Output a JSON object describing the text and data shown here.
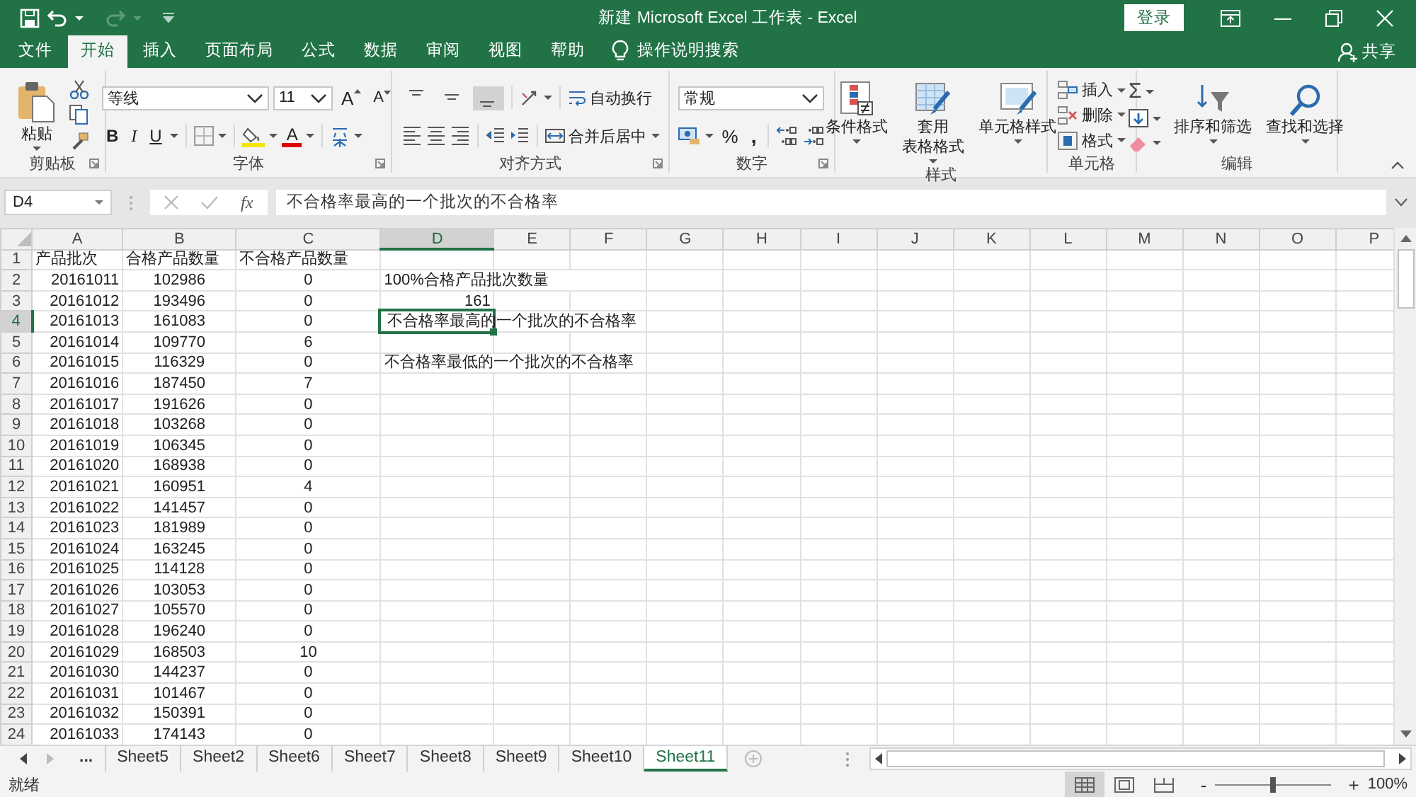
{
  "title_bar": {
    "title": "新建 Microsoft Excel 工作表 - Excel",
    "login": "登录"
  },
  "menu_tabs": [
    {
      "label": "文件",
      "selected": false
    },
    {
      "label": "开始",
      "selected": true
    },
    {
      "label": "插入",
      "selected": false
    },
    {
      "label": "页面布局",
      "selected": false
    },
    {
      "label": "公式",
      "selected": false
    },
    {
      "label": "数据",
      "selected": false
    },
    {
      "label": "审阅",
      "selected": false
    },
    {
      "label": "视图",
      "selected": false
    },
    {
      "label": "帮助",
      "selected": false
    }
  ],
  "tell_me": "操作说明搜索",
  "share": "共享",
  "ribbon": {
    "clipboard": {
      "label": "剪贴板",
      "paste": "粘贴"
    },
    "font": {
      "label": "字体",
      "font_name": "等线",
      "font_size": "11",
      "grow": "A",
      "shrink": "A",
      "bold": "B",
      "italic": "I",
      "underline": "U",
      "font_color": "A"
    },
    "alignment": {
      "label": "对齐方式",
      "vertical_align": [
        {
          "selected": false
        },
        {
          "selected": false
        },
        {
          "selected": true
        }
      ],
      "wrap_text": "自动换行",
      "merge_center": "合并后居中"
    },
    "number": {
      "label": "数字",
      "format": "常规",
      "percent": "%",
      "comma": ","
    },
    "styles": {
      "label": "样式",
      "buttons": [
        {
          "lines": [
            "条件格式"
          ]
        },
        {
          "lines": [
            "套用",
            "表格格式"
          ]
        },
        {
          "lines": [
            "单元格样式"
          ]
        }
      ]
    },
    "cells": {
      "label": "单元格",
      "buttons": [
        "插入",
        "删除",
        "格式"
      ]
    },
    "editing": {
      "label": "编辑",
      "sum": "Σ",
      "buttons": [
        "排序和筛选",
        "查找和选择"
      ]
    }
  },
  "formula_bar": {
    "name_box": "D4",
    "fx": "fx",
    "formula": "不合格率最高的一个批次的不合格率"
  },
  "columns": [
    {
      "label": "A",
      "selected": false
    },
    {
      "label": "B",
      "selected": false
    },
    {
      "label": "C",
      "selected": false
    },
    {
      "label": "D",
      "selected": true
    },
    {
      "label": "E",
      "selected": false
    },
    {
      "label": "F",
      "selected": false
    },
    {
      "label": "G",
      "selected": false
    },
    {
      "label": "H",
      "selected": false
    },
    {
      "label": "I",
      "selected": false
    },
    {
      "label": "J",
      "selected": false
    },
    {
      "label": "K",
      "selected": false
    },
    {
      "label": "L",
      "selected": false
    },
    {
      "label": "M",
      "selected": false
    },
    {
      "label": "N",
      "selected": false
    },
    {
      "label": "O",
      "selected": false
    },
    {
      "label": "P",
      "selected": false
    }
  ],
  "rows": [
    {
      "number": "1",
      "selected": false,
      "cells": [
        {
          "text": "产品批次",
          "kind": "text",
          "selected": false
        },
        {
          "text": "合格产品数量",
          "kind": "text",
          "selected": false
        },
        {
          "text": "不合格产品数量",
          "kind": "text",
          "selected": false
        }
      ]
    },
    {
      "number": "2",
      "selected": false,
      "cells": [
        {
          "text": "20161011",
          "kind": "number",
          "selected": false
        },
        {
          "text": "102986",
          "kind": "centered",
          "selected": false
        },
        {
          "text": "0",
          "kind": "centered",
          "selected": false
        },
        {
          "text": "100%合格产品批次数量",
          "kind": "text",
          "selected": false
        }
      ]
    },
    {
      "number": "3",
      "selected": false,
      "cells": [
        {
          "text": "20161012",
          "kind": "number",
          "selected": false
        },
        {
          "text": "193496",
          "kind": "centered",
          "selected": false
        },
        {
          "text": "0",
          "kind": "centered",
          "selected": false
        },
        {
          "text": "161",
          "kind": "number",
          "selected": false
        }
      ]
    },
    {
      "number": "4",
      "selected": true,
      "cells": [
        {
          "text": "20161013",
          "kind": "number",
          "selected": false
        },
        {
          "text": "161083",
          "kind": "centered",
          "selected": false
        },
        {
          "text": "0",
          "kind": "centered",
          "selected": false
        },
        {
          "text": "不合格率最高的一个批次的不合格率",
          "kind": "text",
          "selected": true
        }
      ]
    },
    {
      "number": "5",
      "selected": false,
      "cells": [
        {
          "text": "20161014",
          "kind": "number",
          "selected": false
        },
        {
          "text": "109770",
          "kind": "centered",
          "selected": false
        },
        {
          "text": "6",
          "kind": "centered",
          "selected": false
        }
      ]
    },
    {
      "number": "6",
      "selected": false,
      "cells": [
        {
          "text": "20161015",
          "kind": "number",
          "selected": false
        },
        {
          "text": "116329",
          "kind": "centered",
          "selected": false
        },
        {
          "text": "0",
          "kind": "centered",
          "selected": false
        },
        {
          "text": "不合格率最低的一个批次的不合格率",
          "kind": "text",
          "selected": false
        }
      ]
    },
    {
      "number": "7",
      "selected": false,
      "cells": [
        {
          "text": "20161016",
          "kind": "number",
          "selected": false
        },
        {
          "text": "187450",
          "kind": "centered",
          "selected": false
        },
        {
          "text": "7",
          "kind": "centered",
          "selected": false
        }
      ]
    },
    {
      "number": "8",
      "selected": false,
      "cells": [
        {
          "text": "20161017",
          "kind": "number",
          "selected": false
        },
        {
          "text": "191626",
          "kind": "centered",
          "selected": false
        },
        {
          "text": "0",
          "kind": "centered",
          "selected": false
        }
      ]
    },
    {
      "number": "9",
      "selected": false,
      "cells": [
        {
          "text": "20161018",
          "kind": "number",
          "selected": false
        },
        {
          "text": "103268",
          "kind": "centered",
          "selected": false
        },
        {
          "text": "0",
          "kind": "centered",
          "selected": false
        }
      ]
    },
    {
      "number": "10",
      "selected": false,
      "cells": [
        {
          "text": "20161019",
          "kind": "number",
          "selected": false
        },
        {
          "text": "106345",
          "kind": "centered",
          "selected": false
        },
        {
          "text": "0",
          "kind": "centered",
          "selected": false
        }
      ]
    },
    {
      "number": "11",
      "selected": false,
      "cells": [
        {
          "text": "20161020",
          "kind": "number",
          "selected": false
        },
        {
          "text": "168938",
          "kind": "centered",
          "selected": false
        },
        {
          "text": "0",
          "kind": "centered",
          "selected": false
        }
      ]
    },
    {
      "number": "12",
      "selected": false,
      "cells": [
        {
          "text": "20161021",
          "kind": "number",
          "selected": false
        },
        {
          "text": "160951",
          "kind": "centered",
          "selected": false
        },
        {
          "text": "4",
          "kind": "centered",
          "selected": false
        }
      ]
    },
    {
      "number": "13",
      "selected": false,
      "cells": [
        {
          "text": "20161022",
          "kind": "number",
          "selected": false
        },
        {
          "text": "141457",
          "kind": "centered",
          "selected": false
        },
        {
          "text": "0",
          "kind": "centered",
          "selected": false
        }
      ]
    },
    {
      "number": "14",
      "selected": false,
      "cells": [
        {
          "text": "20161023",
          "kind": "number",
          "selected": false
        },
        {
          "text": "181989",
          "kind": "centered",
          "selected": false
        },
        {
          "text": "0",
          "kind": "centered",
          "selected": false
        }
      ]
    },
    {
      "number": "15",
      "selected": false,
      "cells": [
        {
          "text": "20161024",
          "kind": "number",
          "selected": false
        },
        {
          "text": "163245",
          "kind": "centered",
          "selected": false
        },
        {
          "text": "0",
          "kind": "centered",
          "selected": false
        }
      ]
    },
    {
      "number": "16",
      "selected": false,
      "cells": [
        {
          "text": "20161025",
          "kind": "number",
          "selected": false
        },
        {
          "text": "114128",
          "kind": "centered",
          "selected": false
        },
        {
          "text": "0",
          "kind": "centered",
          "selected": false
        }
      ]
    },
    {
      "number": "17",
      "selected": false,
      "cells": [
        {
          "text": "20161026",
          "kind": "number",
          "selected": false
        },
        {
          "text": "103053",
          "kind": "centered",
          "selected": false
        },
        {
          "text": "0",
          "kind": "centered",
          "selected": false
        }
      ]
    },
    {
      "number": "18",
      "selected": false,
      "cells": [
        {
          "text": "20161027",
          "kind": "number",
          "selected": false
        },
        {
          "text": "105570",
          "kind": "centered",
          "selected": false
        },
        {
          "text": "0",
          "kind": "centered",
          "selected": false
        }
      ]
    },
    {
      "number": "19",
      "selected": false,
      "cells": [
        {
          "text": "20161028",
          "kind": "number",
          "selected": false
        },
        {
          "text": "196240",
          "kind": "centered",
          "selected": false
        },
        {
          "text": "0",
          "kind": "centered",
          "selected": false
        }
      ]
    },
    {
      "number": "20",
      "selected": false,
      "cells": [
        {
          "text": "20161029",
          "kind": "number",
          "selected": false
        },
        {
          "text": "168503",
          "kind": "centered",
          "selected": false
        },
        {
          "text": "10",
          "kind": "centered",
          "selected": false
        }
      ]
    },
    {
      "number": "21",
      "selected": false,
      "cells": [
        {
          "text": "20161030",
          "kind": "number",
          "selected": false
        },
        {
          "text": "144237",
          "kind": "centered",
          "selected": false
        },
        {
          "text": "0",
          "kind": "centered",
          "selected": false
        }
      ]
    },
    {
      "number": "22",
      "selected": false,
      "cells": [
        {
          "text": "20161031",
          "kind": "number",
          "selected": false
        },
        {
          "text": "101467",
          "kind": "centered",
          "selected": false
        },
        {
          "text": "0",
          "kind": "centered",
          "selected": false
        }
      ]
    },
    {
      "number": "23",
      "selected": false,
      "cells": [
        {
          "text": "20161032",
          "kind": "number",
          "selected": false
        },
        {
          "text": "150391",
          "kind": "centered",
          "selected": false
        },
        {
          "text": "0",
          "kind": "centered",
          "selected": false
        }
      ]
    },
    {
      "number": "24",
      "selected": false,
      "cells": [
        {
          "text": "20161033",
          "kind": "number",
          "selected": false
        },
        {
          "text": "174143",
          "kind": "centered",
          "selected": false
        },
        {
          "text": "0",
          "kind": "centered",
          "selected": false
        }
      ]
    }
  ],
  "sheet_tabs": {
    "more": "...",
    "tabs": [
      {
        "label": "Sheet5",
        "selected": false
      },
      {
        "label": "Sheet2",
        "selected": false
      },
      {
        "label": "Sheet6",
        "selected": false
      },
      {
        "label": "Sheet7",
        "selected": false
      },
      {
        "label": "Sheet8",
        "selected": false
      },
      {
        "label": "Sheet9",
        "selected": false
      },
      {
        "label": "Sheet10",
        "selected": false
      },
      {
        "label": "Sheet11",
        "selected": true
      }
    ]
  },
  "status_bar": {
    "status": "就绪",
    "views": [
      {
        "selected": true
      },
      {
        "selected": false
      },
      {
        "selected": false
      }
    ],
    "zoom_out": "-",
    "zoom_in": "+",
    "zoom": {
      "level": 0.5
    },
    "zoom_reading": "100%"
  }
}
